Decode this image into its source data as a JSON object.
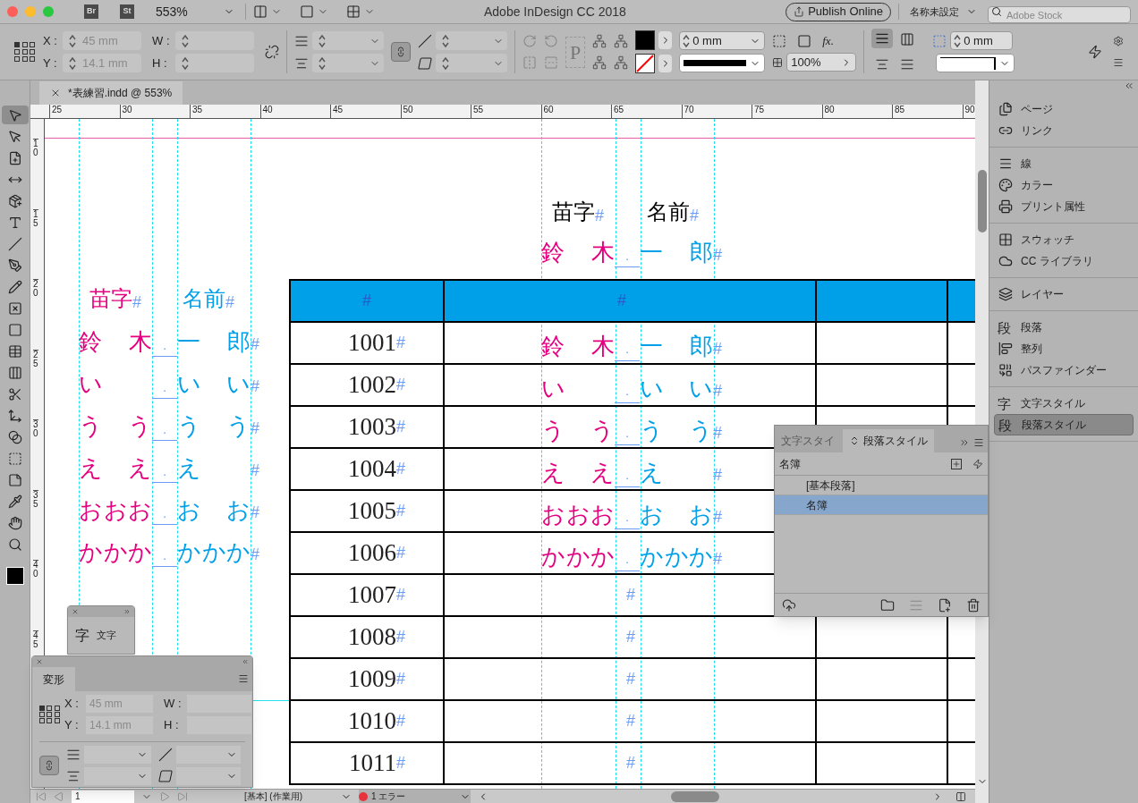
{
  "title_bar": {
    "apps": [
      "Br",
      "St"
    ],
    "zoom": "553%",
    "title": "Adobe InDesign CC 2018",
    "publish_button": "Publish Online",
    "workspace": "名称未設定",
    "stock_search_placeholder": "Adobe Stock"
  },
  "control_panel": {
    "x_label": "X :",
    "x_value": "45 mm",
    "y_label": "Y :",
    "y_value": "14.1 mm",
    "w_label": "W :",
    "h_label": "H :",
    "text_frame_glyph": "P",
    "effects_glyph": "fx.",
    "stroke_weight": "0 mm",
    "opacity": "100%",
    "frame_offset": "0 mm"
  },
  "document_tab": {
    "title": "*表練習.indd @ 553%"
  },
  "tools": [
    {
      "selected": true
    },
    {
      "selected": false
    },
    {
      "selected": false
    },
    {
      "selected": false
    },
    {
      "selected": false
    },
    {
      "selected": false
    },
    {
      "selected": false
    },
    {
      "selected": false
    },
    {
      "selected": false
    },
    {
      "selected": false
    },
    {
      "selected": false
    },
    {
      "selected": false
    },
    {
      "selected": false
    },
    {
      "selected": false
    },
    {
      "selected": false
    },
    {
      "selected": false
    },
    {
      "selected": false
    },
    {
      "selected": false
    },
    {
      "selected": false
    },
    {
      "selected": false
    },
    {
      "selected": false
    }
  ],
  "rulers": {
    "horizontal": [
      "25",
      "30",
      "35",
      "40",
      "45",
      "50",
      "55",
      "60",
      "65",
      "70",
      "75",
      "80",
      "85",
      "90"
    ],
    "vertical": [
      "10",
      "15",
      "20",
      "25",
      "30",
      "35",
      "40",
      "45"
    ]
  },
  "hidden_marks": {
    "paragraph_end": "#",
    "tab": "·"
  },
  "sample_list": {
    "surname_heading": "苗字",
    "given_heading": "名前",
    "rows": [
      {
        "surname": "鈴　木",
        "given": "一　郎"
      },
      {
        "surname": "い",
        "given": "い　い"
      },
      {
        "surname": "う　う",
        "given": "う　う"
      },
      {
        "surname": "え　え",
        "given": "え"
      },
      {
        "surname": "おおお",
        "given": "お　お"
      },
      {
        "surname": "かかか",
        "given": "かかか"
      }
    ]
  },
  "table_preview": {
    "surname_heading": "苗字",
    "given_heading": "名前",
    "surname": "鈴　木",
    "given": "一　郎"
  },
  "table": {
    "rows": [
      {
        "number": "1001",
        "surname": "鈴　木",
        "given": "一　郎"
      },
      {
        "number": "1002",
        "surname": "い",
        "given": "い　い"
      },
      {
        "number": "1003",
        "surname": "う　う",
        "given": "う　う"
      },
      {
        "number": "1004",
        "surname": "え　え",
        "given": "え"
      },
      {
        "number": "1005",
        "surname": "おおお",
        "given": "お　お"
      },
      {
        "number": "1006",
        "surname": "かかか",
        "given": "かかか"
      },
      {
        "number": "1007"
      },
      {
        "number": "1008"
      },
      {
        "number": "1009"
      },
      {
        "number": "1010"
      },
      {
        "number": "1011"
      }
    ]
  },
  "dock_groups": [
    [
      {
        "label": "ページ",
        "selected": false
      },
      {
        "label": "リンク",
        "selected": false
      }
    ],
    [
      {
        "label": "線",
        "selected": false
      },
      {
        "label": "カラー",
        "selected": false
      },
      {
        "label": "プリント属性",
        "selected": false
      }
    ],
    [
      {
        "label": "スウォッチ",
        "selected": false
      },
      {
        "label": "CC ライブラリ",
        "selected": false
      }
    ],
    [
      {
        "label": "レイヤー",
        "selected": false
      }
    ],
    [
      {
        "label": "段落",
        "glyph": "段",
        "selected": false
      },
      {
        "label": "整列",
        "selected": false
      },
      {
        "label": "パスファインダー",
        "selected": false
      }
    ],
    [
      {
        "label": "文字スタイル",
        "glyph": "字",
        "selected": false
      },
      {
        "label": "段落スタイル",
        "glyph": "段",
        "selected": true
      }
    ]
  ],
  "styles_panel": {
    "tabs": [
      {
        "label": "文字スタイ",
        "selected": false
      },
      {
        "label": "段落スタイル",
        "selected": true
      }
    ],
    "group": "名簿",
    "items": [
      {
        "label": "[基本段落]",
        "selected": false
      },
      {
        "label": "名簿",
        "selected": true
      }
    ]
  },
  "character_panel": {
    "glyph": "字",
    "label": "文字"
  },
  "transform_panel": {
    "tab": "変形",
    "x_label": "X :",
    "x_value": "45 mm",
    "y_label": "Y :",
    "y_value": "14.1 mm",
    "w_label": "W :",
    "h_label": "H :"
  },
  "status_bar": {
    "page": "1",
    "profile": "[基本] (作業用)",
    "errors": "1 エラー"
  }
}
